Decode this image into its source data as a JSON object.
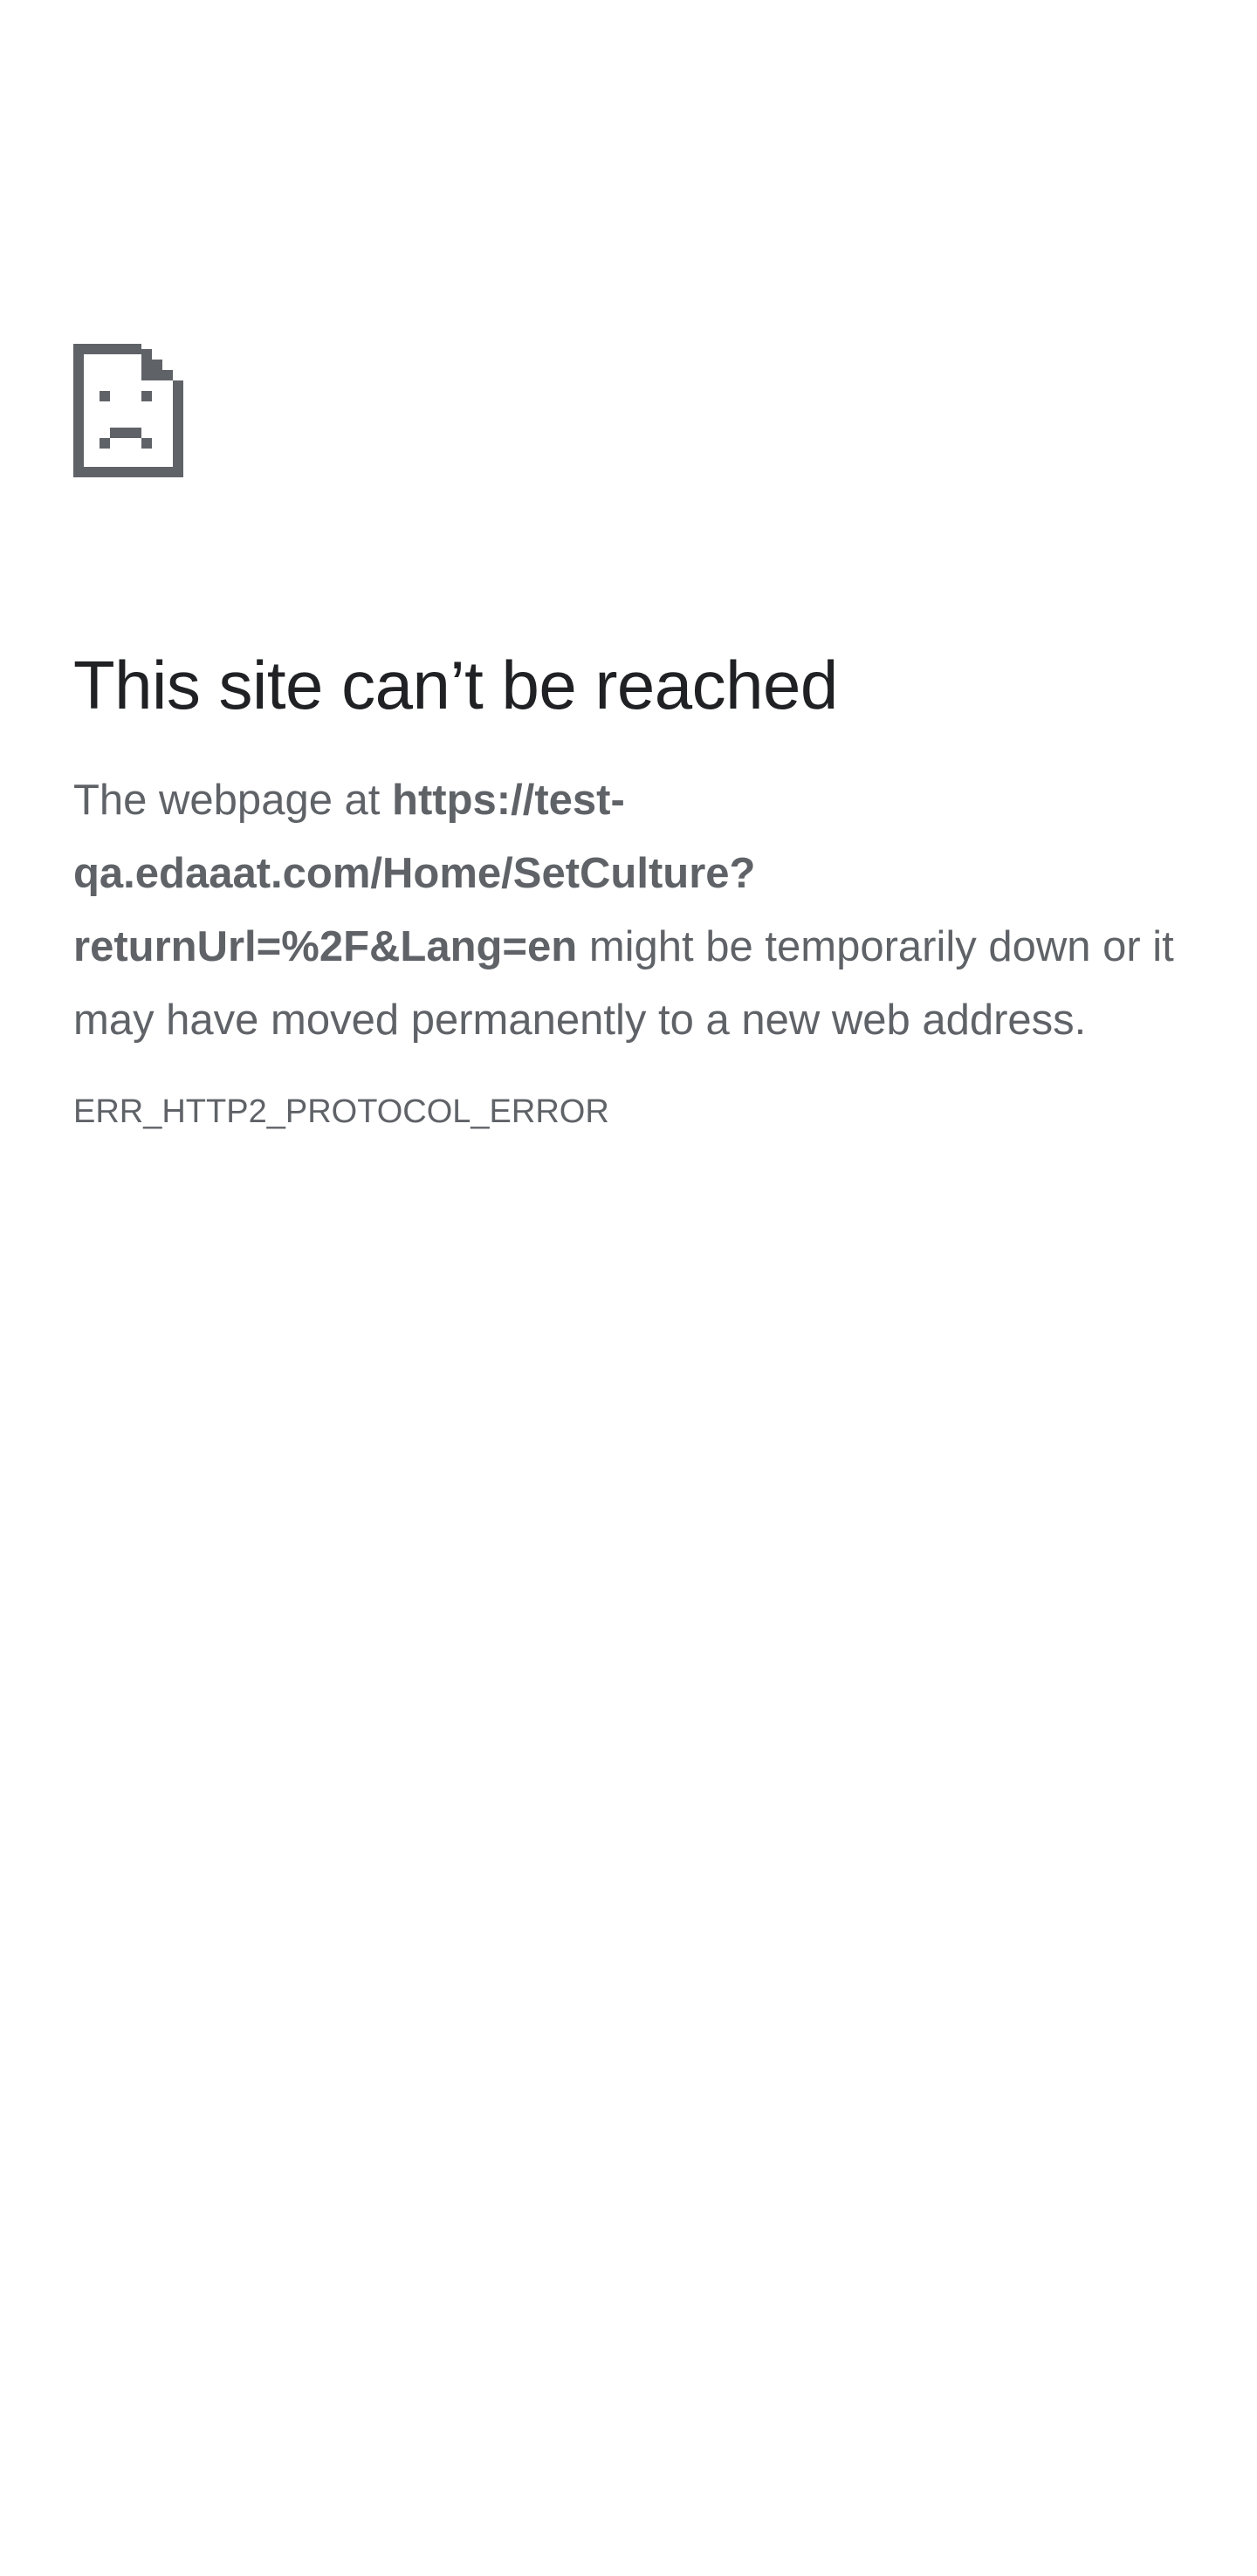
{
  "error_page": {
    "icon": "sad-document-icon",
    "title": "This site can’t be reached",
    "summary_prefix": "The webpage at ",
    "url_line_1": "https://test-",
    "url_line_2": "qa.edaaat.com/Home/SetCulture?",
    "url_line_3": "returnUrl=%2F&Lang=en",
    "summary_suffix": " might be temporarily down or it may have moved permanently to a new web address.",
    "error_code": "ERR_HTTP2_PROTOCOL_ERROR"
  },
  "colors": {
    "title": "#202124",
    "body_text": "#5f6368",
    "icon": "#5f6368",
    "background": "#ffffff"
  }
}
